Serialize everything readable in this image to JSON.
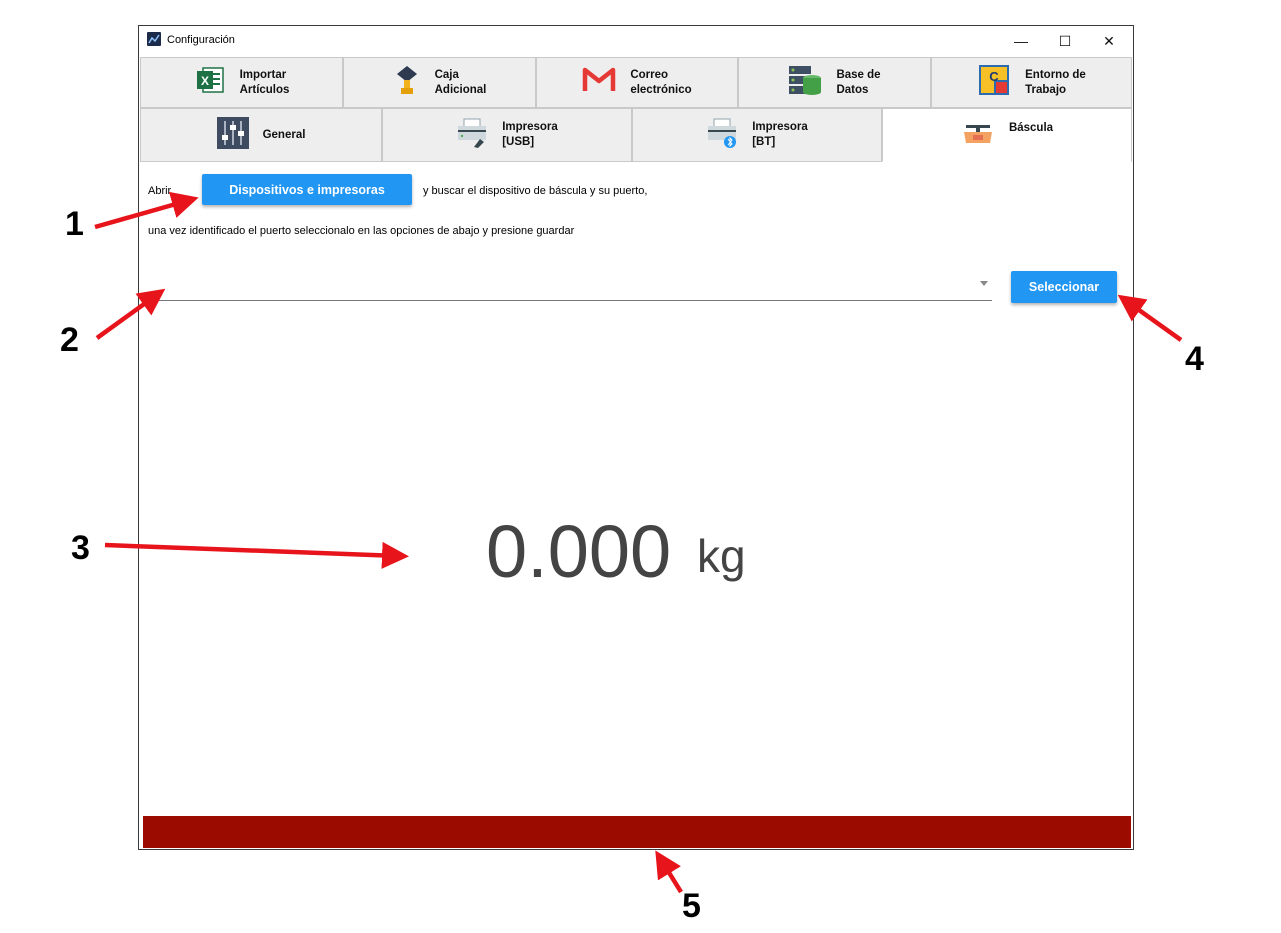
{
  "window": {
    "title": "Configuración",
    "controls": {
      "minimize": "—",
      "maximize": "☐",
      "close": "✕"
    }
  },
  "tabs_top": [
    {
      "label": "Importar\nArtículos",
      "icon": "excel-icon"
    },
    {
      "label": "Caja\nAdicional",
      "icon": "cash-drawer-icon"
    },
    {
      "label": "Correo\nelectrónico",
      "icon": "gmail-icon"
    },
    {
      "label": "Base de\nDatos",
      "icon": "database-icon"
    },
    {
      "label": "Entorno de\nTrabajo",
      "icon": "workspace-puzzle-icon"
    }
  ],
  "tabs_bottom": [
    {
      "label": "General",
      "icon": "sliders-icon",
      "active": false
    },
    {
      "label": "Impresora\n[USB]",
      "icon": "usb-printer-icon",
      "active": false
    },
    {
      "label": "Impresora\n[BT]",
      "icon": "bluetooth-printer-icon",
      "active": false
    },
    {
      "label": "Báscula",
      "icon": "scale-icon",
      "active": true
    }
  ],
  "content": {
    "open_label": "Abrir",
    "devices_button": "Dispositivos e impresoras",
    "search_text": "y buscar el dispositivo de báscula y su puerto,",
    "instruction_text": "una vez identificado el puerto seleccionalo en las opciones de abajo y presione guardar",
    "port_select_value": "",
    "select_button": "Seleccionar",
    "weight_value": "0.000",
    "weight_unit": "kg"
  },
  "status_bar": {
    "color": "#9b0b00"
  },
  "annotations": [
    "1",
    "2",
    "3",
    "4",
    "5"
  ],
  "colors": {
    "accent": "#2196f3",
    "arrow": "#e8141b"
  }
}
